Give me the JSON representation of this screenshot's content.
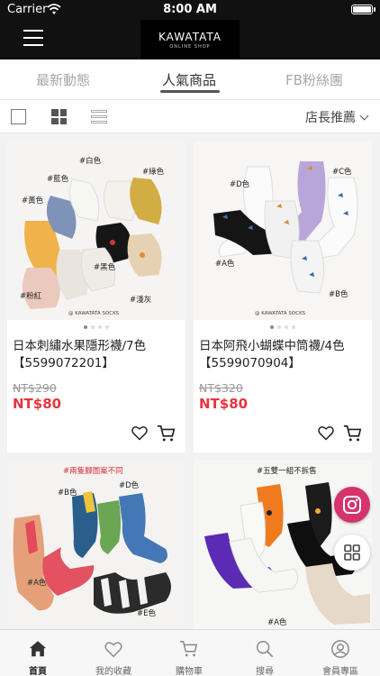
{
  "status_bar": {
    "carrier": "Carrier",
    "time": "8:00 AM"
  },
  "header": {
    "logo_text": "KAWATATA",
    "logo_subtext": "ONLINE SHOP"
  },
  "tabs": [
    {
      "label": "最新動態",
      "active": false
    },
    {
      "label": "人氣商品",
      "active": true
    },
    {
      "label": "FB粉絲團",
      "active": false
    }
  ],
  "toolbar": {
    "sort_label": "店長推薦"
  },
  "products": [
    {
      "name": "日本刺繡水果隱形襪/7色【5599072201】",
      "original_price": "NT$290",
      "price": "NT$80",
      "photo_labels": [
        "#白色",
        "#藍色",
        "#綠色",
        "#黃色",
        "#黑色",
        "#粉紅",
        "#淺灰"
      ],
      "photo_brand": "@ KAWATATA SOCKS",
      "image_count": 4,
      "current_image": 1
    },
    {
      "name": "日本阿飛小蝴蝶中筒襪/4色【5599070904】",
      "original_price": "NT$320",
      "price": "NT$80",
      "photo_labels": [
        "#D色",
        "#C色",
        "#A色",
        "#B色"
      ],
      "photo_brand": "@ KAWATATA SOCKS",
      "image_count": 4,
      "current_image": 1
    },
    {
      "photo_banner": "#兩隻腳圖案不同",
      "photo_labels": [
        "#B色",
        "#D色",
        "#A色",
        "#E色"
      ]
    },
    {
      "photo_banner": "#五雙一組不拆售",
      "photo_labels": [
        "#A色"
      ]
    }
  ],
  "bottom_nav": [
    {
      "label": "首頁",
      "icon": "home-icon",
      "active": true
    },
    {
      "label": "我的收藏",
      "icon": "heart-icon",
      "active": false
    },
    {
      "label": "購物車",
      "icon": "cart-icon",
      "active": false
    },
    {
      "label": "搜尋",
      "icon": "search-icon",
      "active": false
    },
    {
      "label": "會員專區",
      "icon": "user-icon",
      "active": false
    }
  ],
  "colors": {
    "price_red": "#e5343d",
    "header_bg": "#111111",
    "instagram": "#d6336c"
  }
}
